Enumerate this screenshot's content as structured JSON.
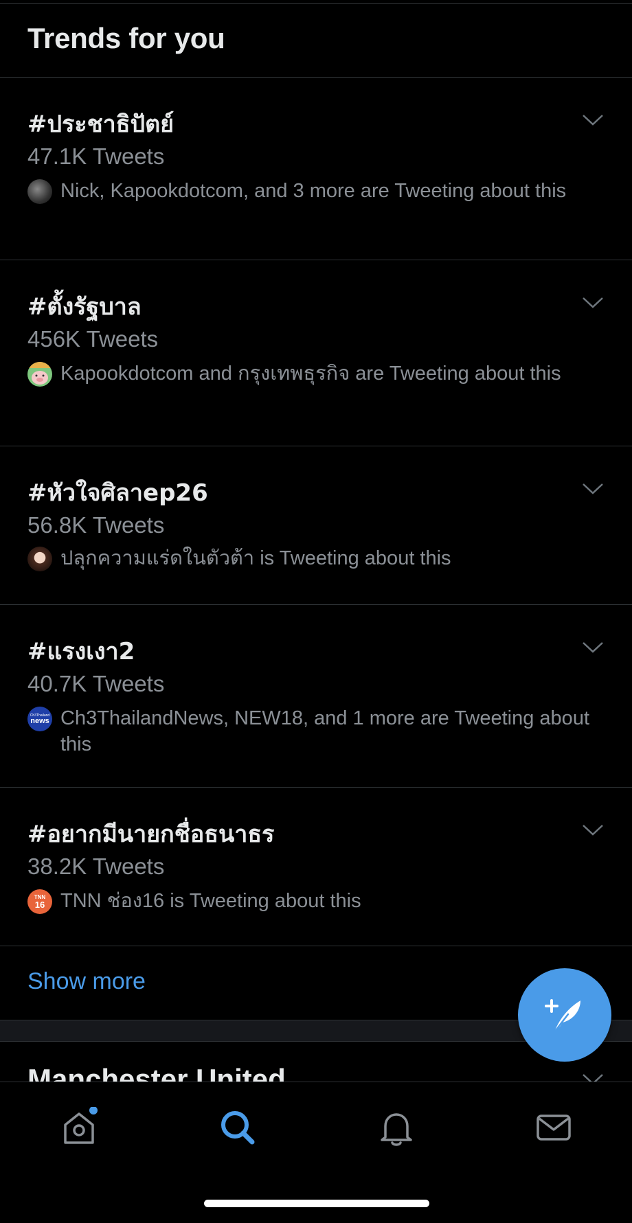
{
  "section": {
    "title": "Trends for you"
  },
  "trends": [
    {
      "tag": "#ประชาธิปัตย์",
      "count": "47.1K Tweets",
      "context": "Nick, Kapookdotcom, and 3 more are Tweeting about this"
    },
    {
      "tag": "#ตั้งรัฐบาล",
      "count": "456K Tweets",
      "context": "Kapookdotcom and กรุงเทพธุรกิจ are Tweeting about this"
    },
    {
      "tag": "#หัวใจศิลาep26",
      "count": "56.8K Tweets",
      "context": "ปลุกความแร่ดในตัวต้า is Tweeting about this"
    },
    {
      "tag": "#แรงเงา2",
      "count": "40.7K Tweets",
      "context": "Ch3ThailandNews, NEW18, and 1 more are Tweeting about this"
    },
    {
      "tag": "#อยากมีนายกชื่อธนาธร",
      "count": "38.2K Tweets",
      "context": "TNN ช่อง16 is Tweeting about this"
    }
  ],
  "avatars": {
    "news_badge": {
      "top": "Ch3Thailand",
      "main": "news"
    },
    "tnn_badge": {
      "top": "TNN",
      "main": "16"
    }
  },
  "show_more": "Show more",
  "next_section": {
    "title": "Manchester United"
  },
  "tabbar": {
    "items": [
      {
        "name": "home",
        "icon": "home-icon",
        "active": false,
        "has_dot": true
      },
      {
        "name": "search",
        "icon": "search-icon",
        "active": true
      },
      {
        "name": "notifications",
        "icon": "bell-icon",
        "active": false
      },
      {
        "name": "messages",
        "icon": "mail-icon",
        "active": false
      }
    ]
  },
  "colors": {
    "accent": "#4a9be8",
    "background": "#000000",
    "primary_text": "#e7e9ea",
    "secondary_text": "#8b9096",
    "divider": "#2f3336"
  }
}
